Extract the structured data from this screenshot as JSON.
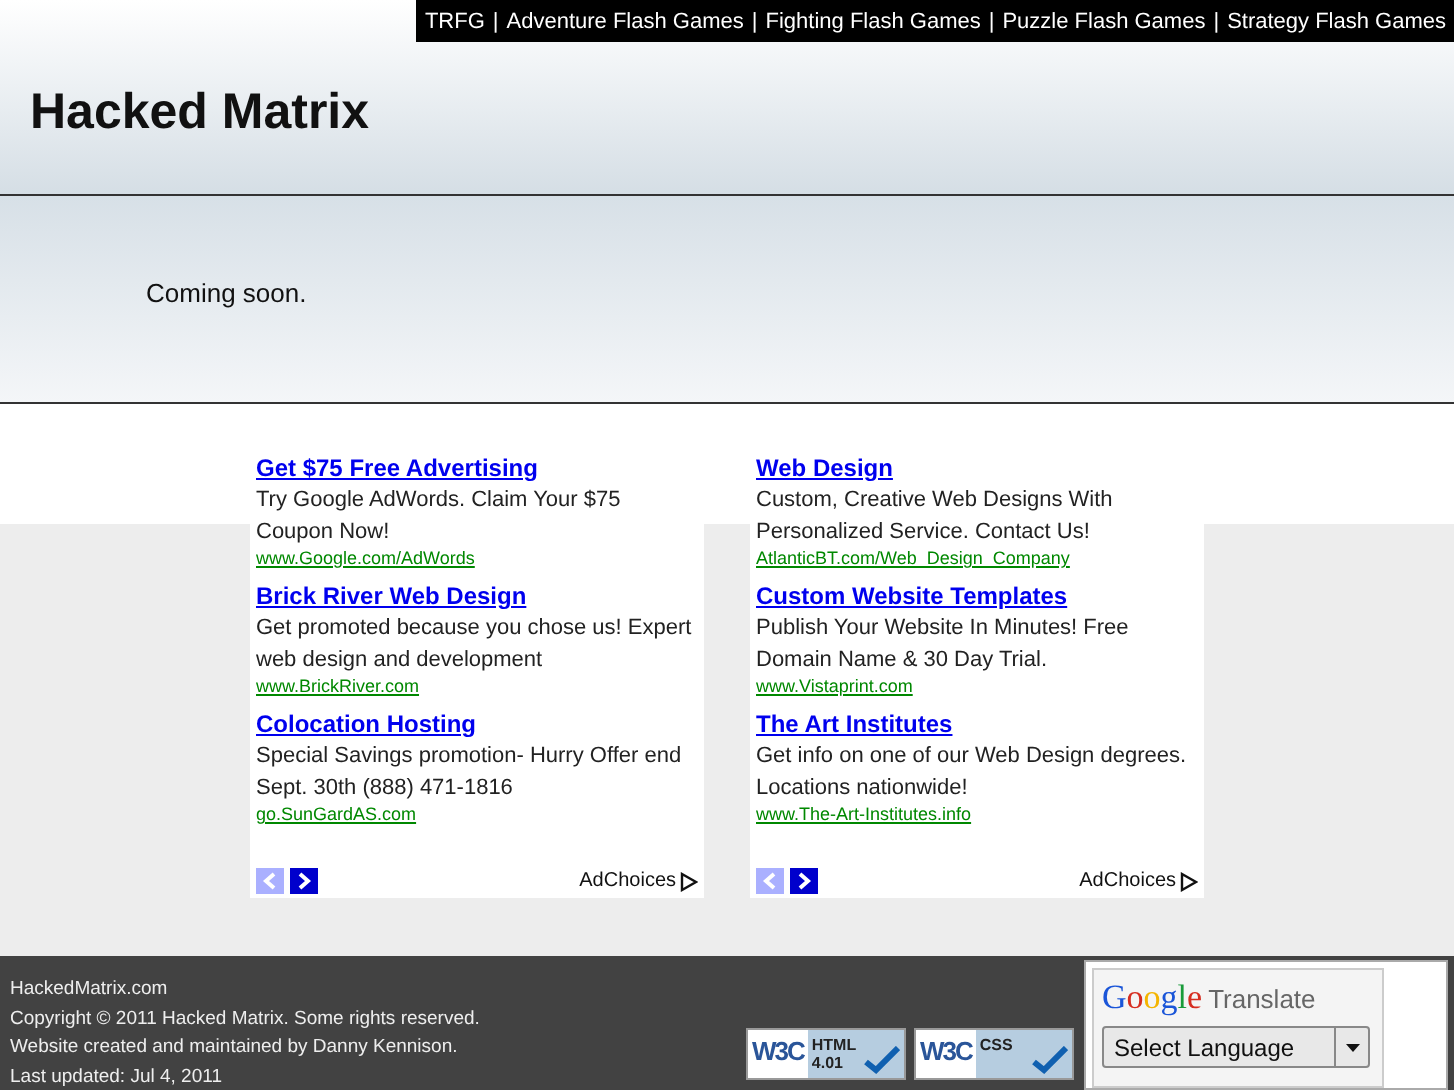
{
  "top_nav": [
    {
      "kind": "link",
      "text": "TRFG"
    },
    {
      "kind": "separator",
      "text": "|"
    },
    {
      "kind": "link",
      "text": "Adventure Flash Games"
    },
    {
      "kind": "separator",
      "text": "|"
    },
    {
      "kind": "link",
      "text": "Fighting Flash Games"
    },
    {
      "kind": "separator",
      "text": "|"
    },
    {
      "kind": "link",
      "text": "Puzzle Flash Games"
    },
    {
      "kind": "separator",
      "text": "|"
    },
    {
      "kind": "link",
      "text": "Strategy Flash Games"
    }
  ],
  "site_title": "Hacked Matrix",
  "content": "Coming soon.",
  "ad_blocks": [
    {
      "ads": [
        {
          "title": "Get $75 Free Advertising",
          "text": "Try Google AdWords. Claim Your $75 Coupon Now!",
          "url": "www.Google.com/AdWords"
        },
        {
          "title": "Brick River Web Design",
          "text": "Get promoted because you chose us! Expert web design and development",
          "url": "www.BrickRiver.com"
        },
        {
          "title": "Colocation Hosting",
          "text": "Special Savings promotion- Hurry Offer end Sept. 30th (888) 471-1816",
          "url": "go.SunGardAS.com"
        }
      ],
      "adchoices": "AdChoices"
    },
    {
      "ads": [
        {
          "title": "Web Design",
          "text": "Custom, Creative Web Designs With Personalized Service. Contact Us!",
          "url": "AtlanticBT.com/Web_Design_Company"
        },
        {
          "title": "Custom Website Templates",
          "text": "Publish Your Website In Minutes! Free Domain Name & 30 Day Trial.",
          "url": "www.Vistaprint.com"
        },
        {
          "title": "The Art Institutes",
          "text": "Get info on one of our Web Design degrees. Locations nationwide!",
          "url": "www.The-Art-Institutes.info"
        }
      ],
      "adchoices": "AdChoices"
    }
  ],
  "footer": {
    "lines": [
      "HackedMatrix.com",
      "Copyright © 2011 Hacked Matrix. Some rights reserved.",
      "Website created and maintained by Danny Kennison.",
      "Last updated: Jul 4, 2011"
    ],
    "badges": [
      {
        "logo": "W3C",
        "label": "HTML",
        "version": "4.01"
      },
      {
        "logo": "W3C",
        "label": "CSS"
      }
    ],
    "translate": {
      "brand": "Google",
      "title": "Translate",
      "select": "Select Language"
    }
  }
}
